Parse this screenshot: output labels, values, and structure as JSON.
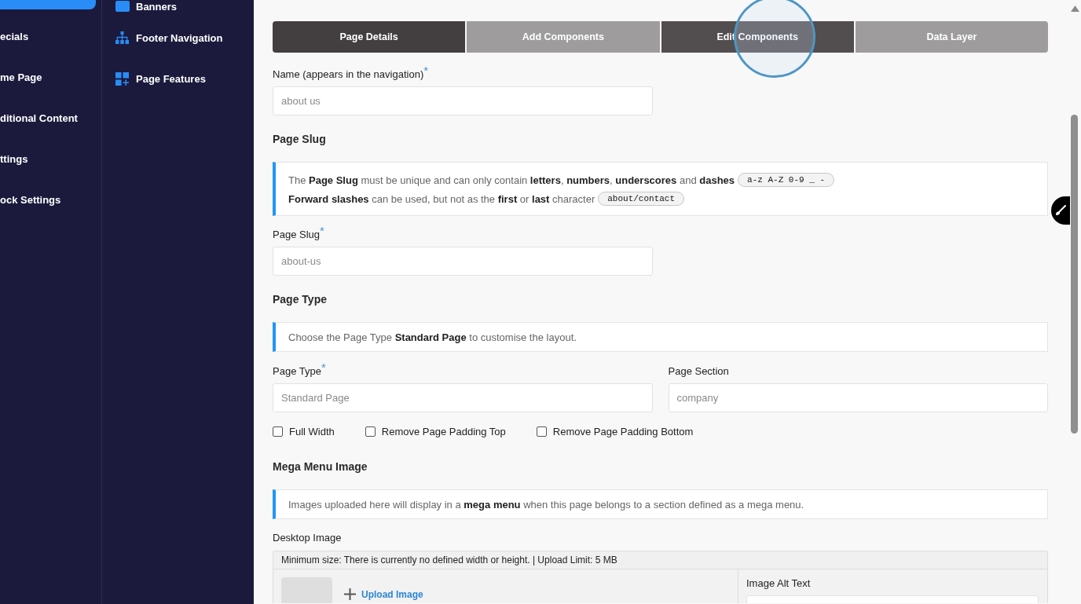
{
  "sidebar": {
    "items": [
      {
        "selected": true
      },
      {
        "label": "ecials",
        "selected": false
      },
      {
        "label": "me Page",
        "selected": false
      },
      {
        "label": "ditional Content",
        "selected": false
      },
      {
        "label": "ttings",
        "selected": false
      },
      {
        "label": "ock Settings",
        "selected": false
      }
    ]
  },
  "submenu": {
    "items": [
      {
        "label": "Banners"
      },
      {
        "label": "Footer Navigation"
      },
      {
        "label": "Page Features"
      }
    ]
  },
  "tabs": [
    {
      "label": "Page Details",
      "selected": true,
      "hovered": false
    },
    {
      "label": "Add Components",
      "selected": false,
      "hovered": false
    },
    {
      "label": "Edit Components",
      "selected": false,
      "hovered": true
    },
    {
      "label": "Data Layer",
      "selected": false,
      "hovered": false
    }
  ],
  "form": [
    {
      "kind": "field",
      "label": "Name (appears in the navigation)$^{*}$",
      "placeholder": "about us"
    },
    {
      "kind": "heading",
      "text": "Page Slug"
    },
    {
      "kind": "info",
      "lines": [
        {
          "text": "The **Page Slug** must be unique and can only contain **letters**, **numbers**, **underscores** and **dashes**",
          "code": "a-z A-Z 0-9 _ -"
        },
        {
          "text": "**Forward slashes** can be used, but not as the **first** or **last** character",
          "code": "about/contact"
        }
      ]
    },
    {
      "kind": "field",
      "label": "Page Slug$^{*}$",
      "placeholder": "about-us"
    },
    {
      "kind": "heading",
      "text": "Page Type"
    },
    {
      "kind": "info",
      "lines": [
        {
          "text": "Choose the Page Type **Standard Page** to customise the layout."
        }
      ]
    },
    {
      "kind": "field_row",
      "fields": [
        {
          "label": "Page Type$^{*}$",
          "placeholder": "Standard Page"
        },
        {
          "label": "Page Section",
          "placeholder": "company"
        }
      ]
    },
    {
      "kind": "checkboxes",
      "items": [
        {
          "label": "Full Width",
          "checked": false
        },
        {
          "label": "Remove Page Padding Top",
          "checked": false
        },
        {
          "label": "Remove Page Padding Bottom",
          "checked": false
        }
      ]
    },
    {
      "kind": "heading",
      "text": "Mega Menu Image"
    },
    {
      "kind": "info",
      "lines": [
        {
          "text": "Images uploaded here will display in a **mega menu** when this page belongs to a section defined as a mega menu."
        }
      ]
    },
    {
      "kind": "upload",
      "label": "Desktop Image",
      "note": "Minimum size: There is currently no defined width or height. | Upload Limit: 5 MB",
      "action": "Upload Image",
      "alt_text_label": "Image Alt Text"
    }
  ]
}
